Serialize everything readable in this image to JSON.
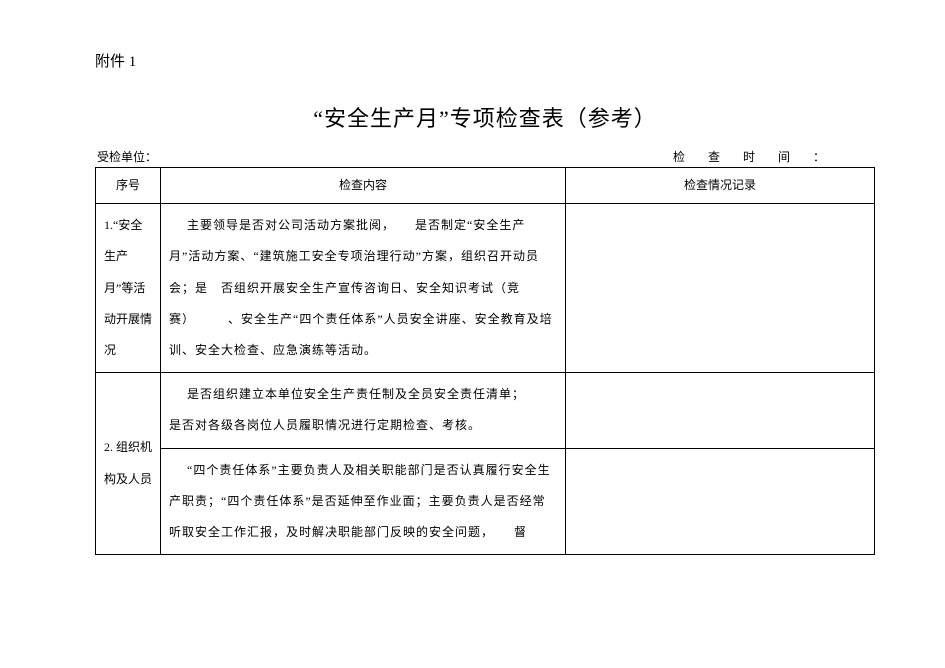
{
  "attachment_label": "附件 1",
  "title": "“安全生产月”专项检查表（参考）",
  "meta": {
    "unit_label": "受检单位：",
    "time_label": "检 查 时 间 ："
  },
  "headers": {
    "idx": "序号",
    "content": "检查内容",
    "record": "检查情况记录"
  },
  "rows": [
    {
      "idx": "1.“安全生产月”等活动开展情况",
      "content": "主要领导是否对公司活动方案批阅，　　是否制定“安全生产月”活动方案、“建筑施工安全专项治理行动”方案，组织召开动员会；是　否组织开展安全生产宣传咨询日、安全知识考试（竞赛）　　　、安全生产“四个责任体系”人员安全讲座、安全教育及培训、安全大检查、应急演练等活动。",
      "record": ""
    },
    {
      "idx": "2. 组织机构及人员",
      "content_parts": [
        "是否组织建立本单位安全生产责任制及全员安全责任清单；　　是否对各级各岗位人员履职情况进行定期检查、考核。",
        "“四个责任体系”主要负责人及相关职能部门是否认真履行安全生产职责；“四个责任体系”是否延伸至作业面；主要负责人是否经常听取安全工作汇报，及时解决职能部门反映的安全问题，　　督"
      ],
      "record": ""
    }
  ]
}
